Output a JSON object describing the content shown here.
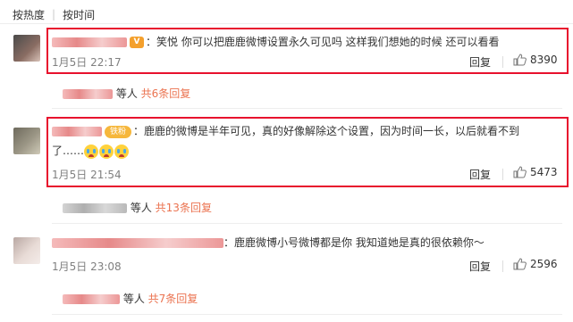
{
  "sort": {
    "by_hot": "按热度",
    "by_time": "按时间"
  },
  "comments": [
    {
      "text": "：笑悦 你可以把鹿鹿微博设置永久可见吗 这样我们想她的时候 还可以看看",
      "time": "1月5日 22:17",
      "reply_label": "回复",
      "likes": "8390",
      "sub_people": "等人",
      "sub_more": "共6条回复"
    },
    {
      "badge_fan": "铁粉",
      "text_line1": "：鹿鹿的微博是半年可见，真的好像解除这个设置，因为时间一长，以后就看不到",
      "text_line2": "了……",
      "time": "1月5日 21:54",
      "reply_label": "回复",
      "likes": "5473",
      "sub_people": "等人",
      "sub_more": "共13条回复"
    },
    {
      "text": "：鹿鹿微博小号微博都是你 我知道她是真的很依赖你～",
      "time": "1月5日 23:08",
      "reply_label": "回复",
      "likes": "2596",
      "sub_people": "等人",
      "sub_more": "共7条回复"
    }
  ],
  "colors": {
    "highlight_box": "#e8112d",
    "more_link": "#eb7350"
  }
}
